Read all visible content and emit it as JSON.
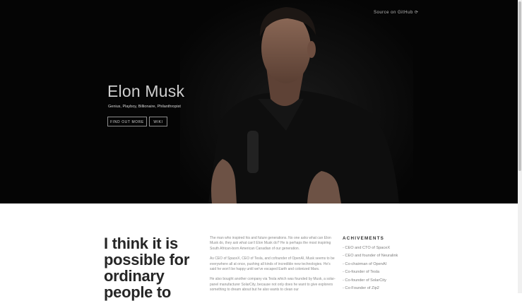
{
  "hero": {
    "source_link": "Source on GitHub ⟳",
    "title": "Elon Musk",
    "subtitle": "Genius, Playboy, Billionaire, Philanthropist",
    "find_out_more": "FIND OUT MORE",
    "wiki": "WIKI"
  },
  "main": {
    "quote": "I think it is possible for ordinary people to",
    "bio": [
      "The man who inspired his and future generations. No one asks what can Elon Musk do, they ask what can't Elon Musk do? He is perhaps the most inspiring South African-born American Canadian of our generation.",
      "As CEO of SpaceX, CEO of Tesla, and cofounder of OpenAI, Musk seems to be everywhere all at once, pushing all kinds of incredible new technologies. He's said he won't be happy until we've escaped Earth and colonized Mars.",
      "He also bought another company via Tesla which was founded by Musk, a solar-panel manufacturer SolarCity, because not only does he want to give explorers something to dream about but he also wants to clean our"
    ],
    "achievements": {
      "heading": "ACHIVEMENTS",
      "items": [
        "- CEO and CTO of SpaceX",
        "- CEO and founder of Neuralink",
        "- Co-chairman of OpenAI",
        "- Co-founder of Tesla",
        "- Co-founder of SolarCity",
        "- Co-Founder of Zip2"
      ]
    }
  }
}
